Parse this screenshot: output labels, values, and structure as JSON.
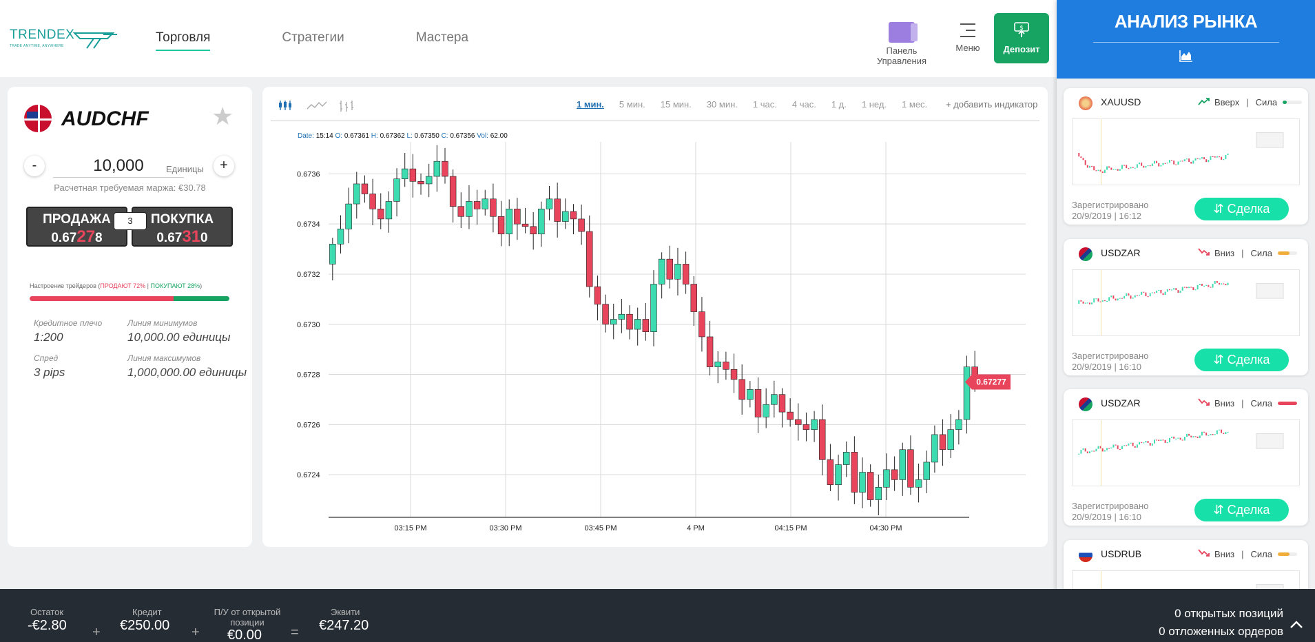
{
  "brand": {
    "name": "TRENDEX",
    "tagline": "TRADE ANYTIME, ANYWHERE"
  },
  "nav": [
    {
      "label": "Торговля",
      "active": true
    },
    {
      "label": "Стратегии",
      "active": false
    },
    {
      "label": "Мастера",
      "active": false
    }
  ],
  "header": {
    "panel_label": "Панель Управления",
    "menu_label": "Меню",
    "deposit_label": "Депозит"
  },
  "instrument": {
    "symbol": "AUDCHF",
    "quantity": "10,000",
    "unit": "Единицы",
    "margin_text": "Расчетная требуемая маржа: €30.78",
    "sell_label": "ПРОДАЖА",
    "sell_price_a": "0.67",
    "sell_price_b": "27",
    "sell_price_c": "8",
    "buy_label": "ПОКУПКА",
    "buy_price_a": "0.67",
    "buy_price_b": "31",
    "buy_price_c": "0",
    "spread": "3",
    "sentiment_prefix": "Настроение трейдеров (",
    "sentiment_sell": "ПРОДАЮТ 72%",
    "sentiment_sep": " | ",
    "sentiment_buy": "ПОКУПАЮТ 28%",
    "sentiment_suffix": ")",
    "sell_pct": 72,
    "buy_pct": 28,
    "leverage_label": "Кредитное плечо",
    "leverage_value": "1:200",
    "min_label": "Линия минимумов",
    "min_value": "10,000.00 единицы",
    "spread_label": "Спред",
    "spread_value": "3 pips",
    "max_label": "Линия максимумов",
    "max_value": "1,000,000.00 единицы"
  },
  "chart_toolbar": {
    "timeframes": [
      "1 мин.",
      "5 мин.",
      "15 мин.",
      "30 мин.",
      "1 час.",
      "4 час.",
      "1 д.",
      "1 нед.",
      "1 мес."
    ],
    "active_timeframe": "1 мин.",
    "add_indicator": "+ добавить индикатор"
  },
  "ohlc": {
    "date_k": "Date:",
    "date_v": "15:14",
    "o_k": "O:",
    "o_v": "0.67361",
    "h_k": "H:",
    "h_v": "0.67362",
    "l_k": "L:",
    "l_v": "0.67350",
    "c_k": "C:",
    "c_v": "0.67356",
    "vol_k": "Vol:",
    "vol_v": "62.00"
  },
  "chart_data": {
    "type": "candlestick",
    "x_ticks": [
      "03:15 PM",
      "03:30 PM",
      "03:45 PM",
      "4 PM",
      "04:15 PM",
      "04:30 PM"
    ],
    "y_ticks": [
      0.6736,
      0.6734,
      0.6732,
      0.673,
      0.6728,
      0.6726,
      0.6724
    ],
    "y_tick_labels": [
      "0.6736",
      "0.6734",
      "0.6732",
      "0.6730",
      "0.6728",
      "0.6726",
      "0.6724"
    ],
    "ylim": [
      0.67223,
      0.6737
    ],
    "last_price_label": "0.67277",
    "last_price": 0.67277,
    "up_color": "#3ddbb0",
    "down_color": "#e8455d",
    "close_path": [
      0.67332,
      0.67338,
      0.67348,
      0.67356,
      0.67352,
      0.67346,
      0.67342,
      0.67349,
      0.67358,
      0.67362,
      0.67357,
      0.67356,
      0.67359,
      0.67365,
      0.67359,
      0.67347,
      0.67343,
      0.67349,
      0.67346,
      0.6735,
      0.67343,
      0.67336,
      0.67346,
      0.6734,
      0.67339,
      0.67336,
      0.67346,
      0.6735,
      0.67341,
      0.67345,
      0.67342,
      0.67337,
      0.67315,
      0.67308,
      0.673,
      0.67302,
      0.67304,
      0.67298,
      0.67302,
      0.67297,
      0.67316,
      0.67326,
      0.67318,
      0.67324,
      0.67316,
      0.67305,
      0.67295,
      0.67283,
      0.67285,
      0.67282,
      0.67278,
      0.6727,
      0.67274,
      0.67263,
      0.67268,
      0.67272,
      0.67265,
      0.67262,
      0.6726,
      0.67258,
      0.67262,
      0.67246,
      0.67236,
      0.67244,
      0.67249,
      0.67233,
      0.67241,
      0.6723,
      0.67235,
      0.67242,
      0.67238,
      0.6725,
      0.67235,
      0.67238,
      0.67245,
      0.67256,
      0.6725,
      0.67258,
      0.67262,
      0.67283,
      0.67277
    ]
  },
  "sidebar": {
    "title": "АНАЛИЗ РЫНКА",
    "cards": [
      {
        "symbol": "XAUUSD",
        "direction": "Вверх",
        "strength_label": "Сила",
        "strength": 0.2,
        "dir_color": "#17a463",
        "strength_color": "#17a463",
        "reg_label": "Зарегистрировано",
        "reg_date": "20/9/2019 | 16:12",
        "button": "⇵ Сделка"
      },
      {
        "symbol": "USDZAR",
        "direction": "Вниз",
        "strength_label": "Сила",
        "strength": 0.6,
        "dir_color": "#e8455d",
        "strength_color": "#f0ad3c",
        "reg_label": "Зарегистрировано",
        "reg_date": "20/9/2019 | 16:10",
        "button": "⇵ Сделка"
      },
      {
        "symbol": "USDZAR",
        "direction": "Вниз",
        "strength_label": "Сила",
        "strength": 1.0,
        "dir_color": "#e8455d",
        "strength_color": "#e8455d",
        "reg_label": "Зарегистрировано",
        "reg_date": "20/9/2019 | 16:10",
        "button": "⇵ Сделка"
      },
      {
        "symbol": "USDRUB",
        "direction": "Вниз",
        "strength_label": "Сила",
        "strength": 0.6,
        "dir_color": "#e8455d",
        "strength_color": "#f0ad3c"
      }
    ]
  },
  "footer": {
    "balance_label": "Остаток",
    "balance_value": "-€2.80",
    "credit_label": "Кредит",
    "credit_value": "€250.00",
    "pl_label": "П/У от открытой позиции",
    "pl_value": "€0.00",
    "equity_label": "Эквити",
    "equity_value": "€247.20",
    "op_plus": "+",
    "op_eq": "=",
    "open_positions": "0 открытых позиций",
    "pending_orders": "0 отложенных ордеров"
  }
}
